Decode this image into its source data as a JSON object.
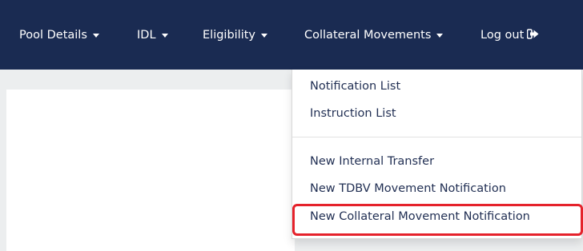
{
  "navbar": {
    "items": [
      {
        "label": "Pool Details",
        "dropdown": true
      },
      {
        "label": "IDL",
        "dropdown": true
      },
      {
        "label": "Eligibility",
        "dropdown": true
      },
      {
        "label": "Collateral Movements",
        "dropdown": true
      },
      {
        "label": "Log out",
        "icon": "sign-out-icon"
      }
    ]
  },
  "dropdown": {
    "items": [
      "Notification List",
      "Instruction List",
      "New Internal Transfer",
      "New TDBV Movement Notification",
      "New Collateral Movement Notification"
    ]
  },
  "colors": {
    "navbar_bg": "#1a2b52",
    "nav_text": "#ffffff",
    "dropdown_text": "#223054",
    "highlight": "#e5222b",
    "page_bg": "#eceeef"
  }
}
